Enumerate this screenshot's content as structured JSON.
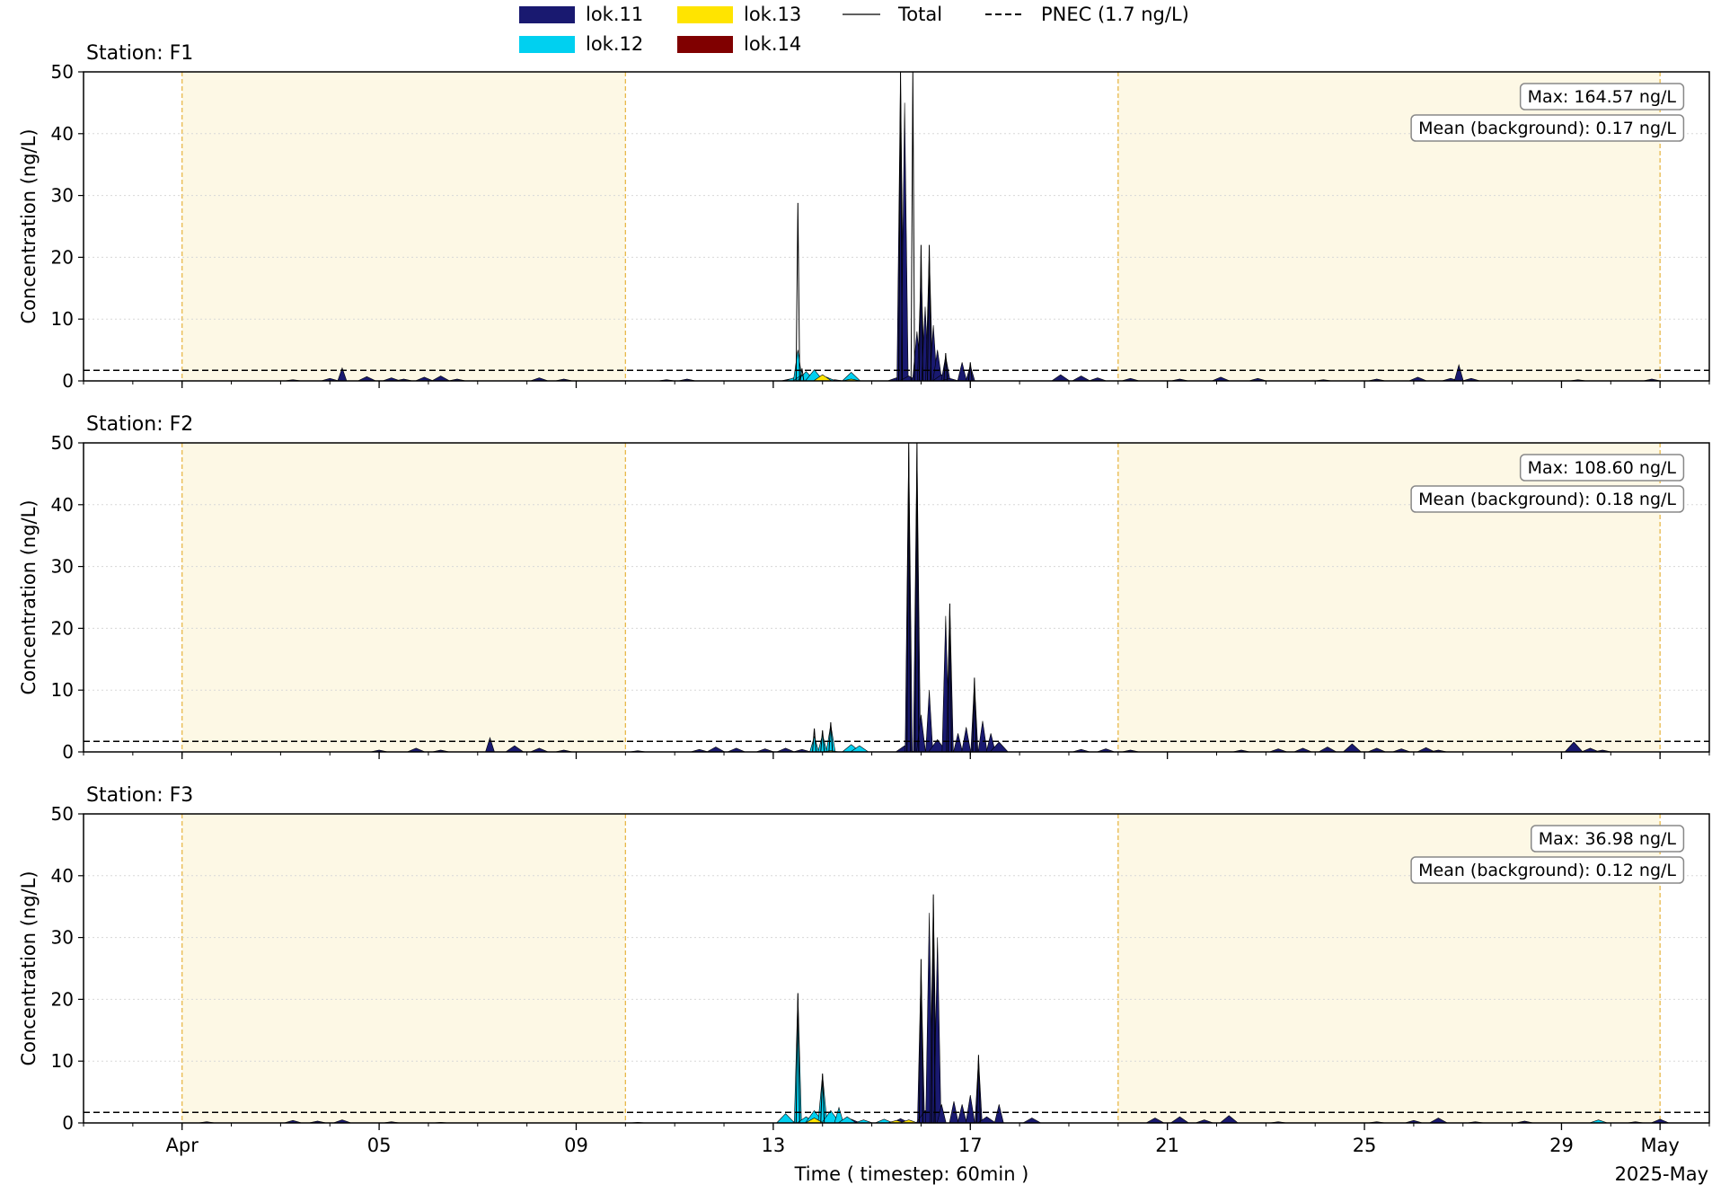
{
  "legend": {
    "items": [
      {
        "label": "lok.11",
        "color": "#191970",
        "kind": "patch"
      },
      {
        "label": "lok.12",
        "color": "#00d0f0",
        "kind": "patch"
      },
      {
        "label": "lok.13",
        "color": "#ffe400",
        "kind": "patch"
      },
      {
        "label": "lok.14",
        "color": "#800000",
        "kind": "patch"
      },
      {
        "label": "Total",
        "color": "#000000",
        "kind": "line"
      },
      {
        "label": "PNEC (1.7 ng/L)",
        "color": "#000000",
        "kind": "dashed"
      }
    ]
  },
  "axis": {
    "ylabel": "Concentration (ng/L)",
    "xlabel": "Time ( timestep: 60min )",
    "x_range": [
      "2025-03-30",
      "2025-05-02"
    ],
    "x_ticks": [
      "Apr",
      "05",
      "09",
      "13",
      "17",
      "21",
      "25",
      "29",
      "May"
    ],
    "x_offset_label": "2025-May",
    "y_ticks": [
      "0",
      "10",
      "20",
      "30",
      "40",
      "50"
    ],
    "ylim": [
      0,
      50
    ]
  },
  "shaded_periods": [
    [
      "2025-04-01",
      "2025-04-10"
    ],
    [
      "2025-04-20",
      "2025-05-01"
    ]
  ],
  "pnec": 1.7,
  "colors": {
    "shade": "#fdf8e5",
    "shade_edge": "#e8b84a",
    "lok11": "#191970",
    "lok12": "#00d0f0",
    "lok13": "#ffe400",
    "lok14": "#800000"
  },
  "chart_data": [
    {
      "type": "area",
      "title": "Station: F1",
      "max_label": "Max: 164.57 ng/L",
      "mean_label": "Mean (background): 0.17 ng/L",
      "series": [
        {
          "name": "lok.11",
          "points": [
            [
              "2025-04-03 06:00",
              0.2
            ],
            [
              "2025-04-04 00:00",
              0.4
            ],
            [
              "2025-04-04 06:00",
              2.1
            ],
            [
              "2025-04-04 18:00",
              0.7
            ],
            [
              "2025-04-05 06:00",
              0.5
            ],
            [
              "2025-04-05 12:00",
              0.3
            ],
            [
              "2025-04-05 22:00",
              0.6
            ],
            [
              "2025-04-06 06:00",
              0.8
            ],
            [
              "2025-04-06 14:00",
              0.3
            ],
            [
              "2025-04-08 06:00",
              0.5
            ],
            [
              "2025-04-08 18:00",
              0.3
            ],
            [
              "2025-04-10 20:00",
              0.2
            ],
            [
              "2025-04-11 06:00",
              0.3
            ],
            [
              "2025-04-13 08:00",
              0.3
            ],
            [
              "2025-04-14 06:00",
              0.2
            ],
            [
              "2025-04-15 12:00",
              0.5
            ],
            [
              "2025-04-15 14:00",
              52.0
            ],
            [
              "2025-04-15 16:00",
              45.0
            ],
            [
              "2025-04-15 18:00",
              0.8
            ],
            [
              "2025-04-15 22:00",
              8.0
            ],
            [
              "2025-04-16 00:00",
              18.0
            ],
            [
              "2025-04-16 02:00",
              12.0
            ],
            [
              "2025-04-16 04:00",
              21.0
            ],
            [
              "2025-04-16 06:00",
              9.0
            ],
            [
              "2025-04-16 08:00",
              5.0
            ],
            [
              "2025-04-16 10:00",
              1.0
            ],
            [
              "2025-04-16 12:00",
              4.0
            ],
            [
              "2025-04-16 14:00",
              0.4
            ],
            [
              "2025-04-16 20:00",
              3.0
            ],
            [
              "2025-04-17 00:00",
              2.5
            ],
            [
              "2025-04-18 20:00",
              1.0
            ],
            [
              "2025-04-19 06:00",
              0.8
            ],
            [
              "2025-04-19 14:00",
              0.5
            ],
            [
              "2025-04-20 06:00",
              0.4
            ],
            [
              "2025-04-21 06:00",
              0.3
            ],
            [
              "2025-04-22 02:00",
              0.6
            ],
            [
              "2025-04-22 20:00",
              0.4
            ],
            [
              "2025-04-24 04:00",
              0.2
            ],
            [
              "2025-04-25 06:00",
              0.3
            ],
            [
              "2025-04-26 02:00",
              0.6
            ],
            [
              "2025-04-26 18:00",
              0.4
            ],
            [
              "2025-04-26 22:00",
              2.6
            ],
            [
              "2025-04-27 04:00",
              0.4
            ],
            [
              "2025-04-29 08:00",
              0.2
            ],
            [
              "2025-04-30 20:00",
              0.3
            ]
          ]
        },
        {
          "name": "lok.12",
          "points": [
            [
              "2025-04-13 10:00",
              0.5
            ],
            [
              "2025-04-13 12:00",
              5.0
            ],
            [
              "2025-04-13 14:00",
              1.0
            ],
            [
              "2025-04-13 16:00",
              1.5
            ],
            [
              "2025-04-13 20:00",
              1.8
            ],
            [
              "2025-04-14 02:00",
              0.6
            ],
            [
              "2025-04-14 14:00",
              1.4
            ]
          ]
        },
        {
          "name": "lok.13",
          "points": [
            [
              "2025-04-14 00:00",
              1.0
            ],
            [
              "2025-04-14 14:00",
              0.3
            ]
          ]
        },
        {
          "name": "lok.14",
          "points": []
        },
        {
          "name": "Total",
          "points": [
            [
              "2025-04-13 12:00",
              28.8
            ],
            [
              "2025-04-13 14:00",
              2.0
            ],
            [
              "2025-04-15 14:00",
              52.0
            ],
            [
              "2025-04-15 20:00",
              50.0
            ],
            [
              "2025-04-16 00:00",
              22.0
            ],
            [
              "2025-04-16 04:00",
              22.0
            ],
            [
              "2025-04-16 12:00",
              4.5
            ],
            [
              "2025-04-17 00:00",
              3.0
            ]
          ]
        }
      ]
    },
    {
      "type": "area",
      "title": "Station: F2",
      "max_label": "Max: 108.60 ng/L",
      "mean_label": "Mean (background): 0.18 ng/L",
      "series": [
        {
          "name": "lok.11",
          "points": [
            [
              "2025-04-05 00:00",
              0.3
            ],
            [
              "2025-04-05 18:00",
              0.6
            ],
            [
              "2025-04-06 06:00",
              0.3
            ],
            [
              "2025-04-07 06:00",
              2.3
            ],
            [
              "2025-04-07 18:00",
              1.0
            ],
            [
              "2025-04-08 06:00",
              0.6
            ],
            [
              "2025-04-08 18:00",
              0.3
            ],
            [
              "2025-04-10 06:00",
              0.2
            ],
            [
              "2025-04-11 12:00",
              0.4
            ],
            [
              "2025-04-11 20:00",
              0.8
            ],
            [
              "2025-04-12 06:00",
              0.6
            ],
            [
              "2025-04-12 20:00",
              0.5
            ],
            [
              "2025-04-13 06:00",
              0.6
            ],
            [
              "2025-04-13 14:00",
              0.4
            ],
            [
              "2025-04-15 16:00",
              1.0
            ],
            [
              "2025-04-15 18:00",
              52.0
            ],
            [
              "2025-04-15 22:00",
              50.0
            ],
            [
              "2025-04-16 00:00",
              6.0
            ],
            [
              "2025-04-16 04:00",
              10.0
            ],
            [
              "2025-04-16 08:00",
              2.0
            ],
            [
              "2025-04-16 12:00",
              22.0
            ],
            [
              "2025-04-16 14:00",
              24.0
            ],
            [
              "2025-04-16 18:00",
              3.0
            ],
            [
              "2025-04-16 22:00",
              4.0
            ],
            [
              "2025-04-17 02:00",
              11.5
            ],
            [
              "2025-04-17 06:00",
              5.0
            ],
            [
              "2025-04-17 10:00",
              3.0
            ],
            [
              "2025-04-17 14:00",
              1.6
            ],
            [
              "2025-04-19 06:00",
              0.4
            ],
            [
              "2025-04-19 18:00",
              0.5
            ],
            [
              "2025-04-20 06:00",
              0.3
            ],
            [
              "2025-04-22 12:00",
              0.3
            ],
            [
              "2025-04-23 06:00",
              0.5
            ],
            [
              "2025-04-23 18:00",
              0.6
            ],
            [
              "2025-04-24 06:00",
              0.8
            ],
            [
              "2025-04-24 18:00",
              1.3
            ],
            [
              "2025-04-25 06:00",
              0.6
            ],
            [
              "2025-04-25 18:00",
              0.5
            ],
            [
              "2025-04-26 06:00",
              0.7
            ],
            [
              "2025-04-26 12:00",
              0.3
            ],
            [
              "2025-04-29 06:00",
              1.6
            ],
            [
              "2025-04-29 14:00",
              0.6
            ],
            [
              "2025-04-29 20:00",
              0.3
            ]
          ]
        },
        {
          "name": "lok.12",
          "points": [
            [
              "2025-04-13 20:00",
              2.5
            ],
            [
              "2025-04-14 00:00",
              2.8
            ],
            [
              "2025-04-14 04:00",
              4.4
            ],
            [
              "2025-04-14 14:00",
              1.2
            ],
            [
              "2025-04-14 18:00",
              1.0
            ]
          ]
        },
        {
          "name": "lok.13",
          "points": [
            [
              "2025-04-14 04:00",
              0.2
            ]
          ]
        },
        {
          "name": "lok.14",
          "points": []
        },
        {
          "name": "Total",
          "points": [
            [
              "2025-04-13 20:00",
              3.8
            ],
            [
              "2025-04-14 00:00",
              3.5
            ],
            [
              "2025-04-14 04:00",
              4.8
            ],
            [
              "2025-04-15 18:00",
              52.0
            ],
            [
              "2025-04-15 22:00",
              50.0
            ],
            [
              "2025-04-16 14:00",
              24.0
            ],
            [
              "2025-04-17 02:00",
              12.0
            ]
          ]
        }
      ]
    },
    {
      "type": "area",
      "title": "Station: F3",
      "max_label": "Max: 36.98 ng/L",
      "mean_label": "Mean (background): 0.12 ng/L",
      "series": [
        {
          "name": "lok.11",
          "points": [
            [
              "2025-04-01 12:00",
              0.2
            ],
            [
              "2025-04-03 06:00",
              0.4
            ],
            [
              "2025-04-03 18:00",
              0.3
            ],
            [
              "2025-04-04 06:00",
              0.5
            ],
            [
              "2025-04-05 06:00",
              0.2
            ],
            [
              "2025-04-06 06:00",
              0.1
            ],
            [
              "2025-04-10 06:00",
              0.1
            ],
            [
              "2025-04-13 10:00",
              0.2
            ],
            [
              "2025-04-14 00:00",
              0.5
            ],
            [
              "2025-04-14 14:00",
              0.6
            ],
            [
              "2025-04-15 14:00",
              0.7
            ],
            [
              "2025-04-16 00:00",
              25.0
            ],
            [
              "2025-04-16 02:00",
              2.0
            ],
            [
              "2025-04-16 04:00",
              34.0
            ],
            [
              "2025-04-16 06:00",
              36.5
            ],
            [
              "2025-04-16 08:00",
              30.0
            ],
            [
              "2025-04-16 10:00",
              3.0
            ],
            [
              "2025-04-16 16:00",
              3.5
            ],
            [
              "2025-04-16 20:00",
              3.0
            ],
            [
              "2025-04-17 00:00",
              4.5
            ],
            [
              "2025-04-17 04:00",
              10.5
            ],
            [
              "2025-04-17 08:00",
              1.0
            ],
            [
              "2025-04-17 14:00",
              3.0
            ],
            [
              "2025-04-18 06:00",
              0.8
            ],
            [
              "2025-04-20 18:00",
              0.8
            ],
            [
              "2025-04-21 06:00",
              1.0
            ],
            [
              "2025-04-21 18:00",
              0.5
            ],
            [
              "2025-04-22 06:00",
              1.2
            ],
            [
              "2025-04-23 06:00",
              0.2
            ],
            [
              "2025-04-25 06:00",
              0.2
            ],
            [
              "2025-04-26 00:00",
              0.4
            ],
            [
              "2025-04-26 12:00",
              0.8
            ],
            [
              "2025-04-27 06:00",
              0.2
            ],
            [
              "2025-04-28 06:00",
              0.3
            ],
            [
              "2025-04-30 12:00",
              0.2
            ],
            [
              "2025-05-01 00:00",
              0.6
            ]
          ]
        },
        {
          "name": "lok.12",
          "points": [
            [
              "2025-04-13 06:00",
              1.5
            ],
            [
              "2025-04-13 12:00",
              21.0
            ],
            [
              "2025-04-13 16:00",
              1.0
            ],
            [
              "2025-04-13 20:00",
              2.0
            ],
            [
              "2025-04-14 00:00",
              7.8
            ],
            [
              "2025-04-14 04:00",
              2.0
            ],
            [
              "2025-04-14 08:00",
              2.5
            ],
            [
              "2025-04-14 12:00",
              1.0
            ],
            [
              "2025-04-14 20:00",
              0.5
            ],
            [
              "2025-04-15 06:00",
              0.6
            ],
            [
              "2025-04-29 18:00",
              0.5
            ]
          ]
        },
        {
          "name": "lok.13",
          "points": [
            [
              "2025-04-13 20:00",
              0.8
            ],
            [
              "2025-04-15 12:00",
              0.4
            ],
            [
              "2025-04-15 18:00",
              0.5
            ]
          ]
        },
        {
          "name": "lok.14",
          "points": []
        },
        {
          "name": "Total",
          "points": [
            [
              "2025-04-13 12:00",
              21.0
            ],
            [
              "2025-04-14 00:00",
              8.0
            ],
            [
              "2025-04-16 00:00",
              26.5
            ],
            [
              "2025-04-16 06:00",
              36.98
            ],
            [
              "2025-04-17 04:00",
              11.0
            ]
          ]
        }
      ]
    }
  ]
}
